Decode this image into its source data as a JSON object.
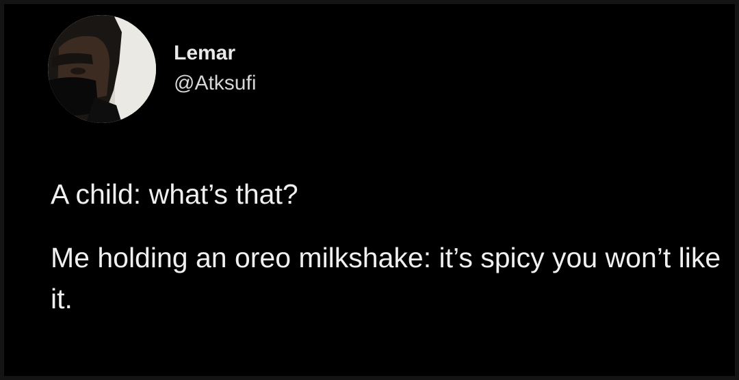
{
  "author": {
    "name": "Lemar",
    "handle": "@Atksufi"
  },
  "tweet": {
    "paragraphs": [
      "A child: what’s that?",
      "Me holding an oreo milkshake: it’s spicy you won’t like it."
    ]
  },
  "colors": {
    "background": "#000000",
    "text": "#f0f0f0"
  }
}
